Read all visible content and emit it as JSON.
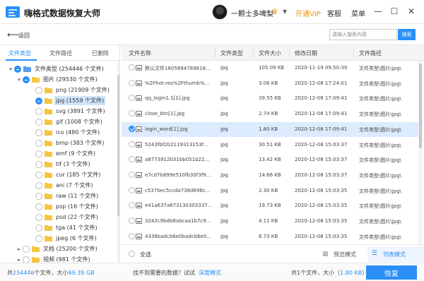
{
  "app": {
    "title": "嗨格式数据恢复大师",
    "user_name": "一颗士多啤梨",
    "vip_link": "开通VIP",
    "service": "客服",
    "menu": "菜单"
  },
  "toolbar": {
    "back_label": "返回",
    "search_placeholder": "请输入搜索内容",
    "search_button": "搜索"
  },
  "sidebar": {
    "tabs": [
      "文件类型",
      "文件路径",
      "已删除"
    ],
    "tree": [
      {
        "label": "文件类型 (254446 个文件)",
        "level": 0,
        "caret": "▾",
        "check": "partial",
        "icon": "folder-blue"
      },
      {
        "label": "图片 (29530 个文件)",
        "level": 1,
        "caret": "▾",
        "check": "partial",
        "icon": "folder"
      },
      {
        "label": "png (21909 个文件)",
        "level": 2,
        "caret": "",
        "check": "",
        "icon": "folder"
      },
      {
        "label": "jpg (1559 个文件)",
        "level": 2,
        "caret": "",
        "check": "partial",
        "icon": "folder",
        "selected": true
      },
      {
        "label": "svg (3891 个文件)",
        "level": 2,
        "caret": "",
        "check": "",
        "icon": "folder"
      },
      {
        "label": "gif (1008 个文件)",
        "level": 2,
        "caret": "",
        "check": "",
        "icon": "folder"
      },
      {
        "label": "ico (480 个文件)",
        "level": 2,
        "caret": "",
        "check": "",
        "icon": "folder"
      },
      {
        "label": "bmp (383 个文件)",
        "level": 2,
        "caret": "",
        "check": "",
        "icon": "folder"
      },
      {
        "label": "emf (9 个文件)",
        "level": 2,
        "caret": "",
        "check": "",
        "icon": "folder"
      },
      {
        "label": "tif (3 个文件)",
        "level": 2,
        "caret": "",
        "check": "",
        "icon": "folder"
      },
      {
        "label": "cur (185 个文件)",
        "level": 2,
        "caret": "",
        "check": "",
        "icon": "folder"
      },
      {
        "label": "ani (7 个文件)",
        "level": 2,
        "caret": "",
        "check": "",
        "icon": "folder"
      },
      {
        "label": "raw (11 个文件)",
        "level": 2,
        "caret": "",
        "check": "",
        "icon": "folder"
      },
      {
        "label": "psp (16 个文件)",
        "level": 2,
        "caret": "",
        "check": "",
        "icon": "folder"
      },
      {
        "label": "psd (22 个文件)",
        "level": 2,
        "caret": "",
        "check": "",
        "icon": "folder"
      },
      {
        "label": "tga (41 个文件)",
        "level": 2,
        "caret": "",
        "check": "",
        "icon": "folder"
      },
      {
        "label": "jpeg (6 个文件)",
        "level": 2,
        "caret": "",
        "check": "",
        "icon": "folder"
      },
      {
        "label": "文档 (25200 个文件)",
        "level": 1,
        "caret": "▸",
        "check": "",
        "icon": "folder"
      },
      {
        "label": "视频 (981 个文件)",
        "level": 1,
        "caret": "▸",
        "check": "",
        "icon": "folder"
      }
    ]
  },
  "list": {
    "columns": [
      "文件名称",
      "文件类型",
      "文件大小",
      "修改日期",
      "文件路径"
    ],
    "rows": [
      {
        "name": "默认文件1605694789818...",
        "type": "jpg",
        "size": "105.09 KB",
        "date": "2020-11-19 09:50:39",
        "path": "文件类型\\图片\\jpg\\",
        "checked": false,
        "selected": false
      },
      {
        "name": "%2Fhot-res%2Fthumb%...",
        "type": "jpg",
        "size": "3.06 KB",
        "date": "2020-12-08 17:24:01",
        "path": "文件类型\\图片\\jpg\\",
        "checked": false,
        "selected": false
      },
      {
        "name": "qq_login1.1[1].jpg",
        "type": "jpg",
        "size": "39.55 KB",
        "date": "2020-12-08 17:09:41",
        "path": "文件类型\\图片\\jpg\\",
        "checked": false,
        "selected": false
      },
      {
        "name": "close_btn[1].jpg",
        "type": "jpg",
        "size": "2.74 KB",
        "date": "2020-12-08 17:09:41",
        "path": "文件类型\\图片\\jpg\\",
        "checked": false,
        "selected": false
      },
      {
        "name": "login_word[1].jpg",
        "type": "jpg",
        "size": "1.80 KB",
        "date": "2020-12-08 17:09:41",
        "path": "文件类型\\图片\\jpg\\",
        "checked": true,
        "selected": true
      },
      {
        "name": "5243fbf2b2119313153f...",
        "type": "jpg",
        "size": "30.51 KB",
        "date": "2020-12-08 15:03:37",
        "path": "文件类型\\图片\\jpg\\",
        "checked": false,
        "selected": false
      },
      {
        "name": "a8773912b31bb051b22...",
        "type": "jpg",
        "size": "13.42 KB",
        "date": "2020-12-08 15:03:37",
        "path": "文件类型\\图片\\jpg\\",
        "checked": false,
        "selected": false
      },
      {
        "name": "e7cd7b899e510fb30f3f9...",
        "type": "jpg",
        "size": "14.66 KB",
        "date": "2020-12-08 15:03:37",
        "path": "文件类型\\图片\\jpg\\",
        "checked": false,
        "selected": false
      },
      {
        "name": "c537bec5ccda736d696c...",
        "type": "jpg",
        "size": "2.30 KB",
        "date": "2020-12-08 15:03:35",
        "path": "文件类型\\图片\\jpg\\",
        "checked": false,
        "selected": false
      },
      {
        "name": "e41a637a673130303337...",
        "type": "jpg",
        "size": "19.73 KB",
        "date": "2020-12-08 15:03:35",
        "path": "文件类型\\图片\\jpg\\",
        "checked": false,
        "selected": false
      },
      {
        "name": "3242c9bdb6abcaa1b7c9...",
        "type": "jpg",
        "size": "4.11 KB",
        "date": "2020-12-08 15:03:35",
        "path": "文件类型\\图片\\jpg\\",
        "checked": false,
        "selected": false
      },
      {
        "name": "4336badcb6e0badcb6e0...",
        "type": "jpg",
        "size": "6.73 KB",
        "date": "2020-12-08 15:03:35",
        "path": "文件类型\\图片\\jpg\\",
        "checked": false,
        "selected": false
      }
    ]
  },
  "bottom": {
    "select_all": "全选",
    "grid_view": "预览模式",
    "list_view": "列表模式"
  },
  "status": {
    "total_prefix": "共",
    "total_count": "254446",
    "total_mid": "个文件，大小",
    "total_size": "69.39 GB",
    "not_found": "找不到需要的数据？试试",
    "deep_scan": "深度模式",
    "selected_prefix": "共1个文件，大小（",
    "selected_size": "1.80 KB",
    "selected_suffix": "）",
    "recover_button": "恢复"
  },
  "colors": {
    "accent": "#2a8ff7",
    "vip": "#e8930c",
    "selected_row": "#dcebfd",
    "folder": "#f5c542"
  }
}
